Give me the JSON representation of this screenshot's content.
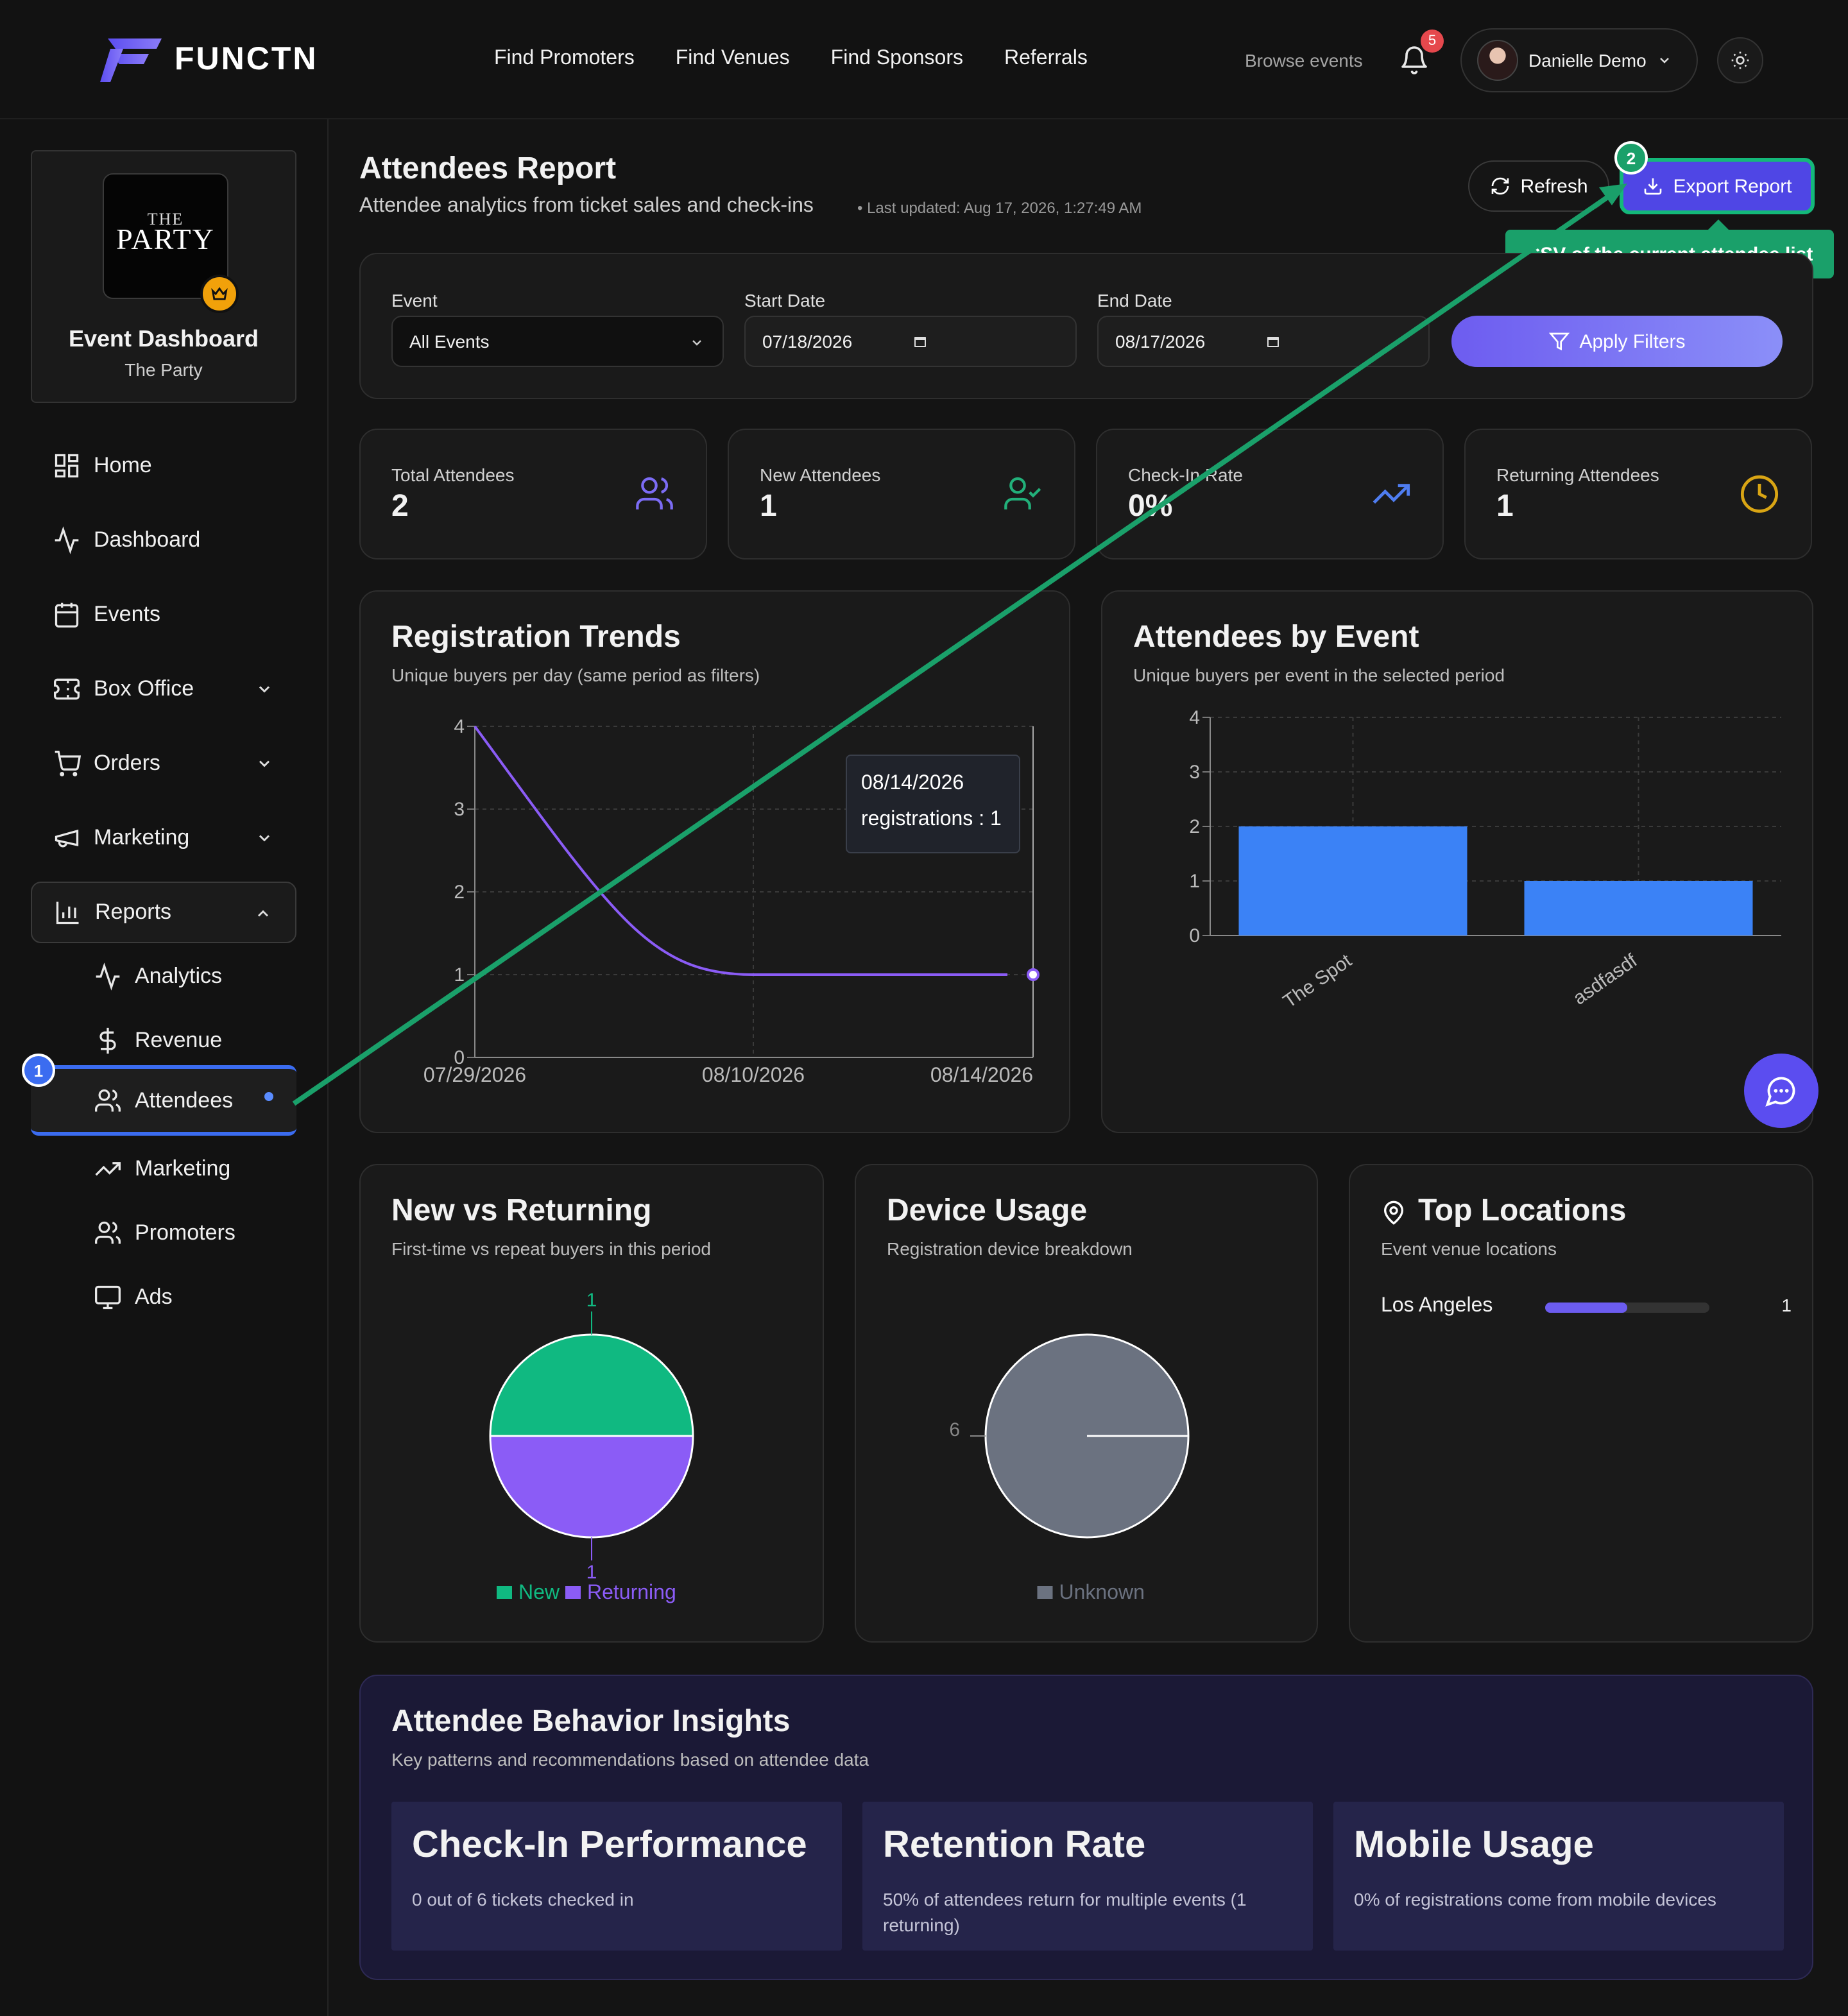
{
  "app": {
    "brand": "FUNCTN",
    "nav_links": [
      "Find Promoters",
      "Find Venues",
      "Find Sponsors",
      "Referrals"
    ],
    "browse_events": "Browse events",
    "notifications_count": "5",
    "user_name": "Danielle Demo"
  },
  "sidebar": {
    "org_logo_small": "THE",
    "org_logo_big": "PARTY",
    "org_title": "Event Dashboard",
    "org_sub": "The Party",
    "items": [
      {
        "label": "Home",
        "icon": "grid-icon"
      },
      {
        "label": "Dashboard",
        "icon": "activity-icon"
      },
      {
        "label": "Events",
        "icon": "calendar-icon"
      },
      {
        "label": "Box Office",
        "icon": "ticket-icon"
      },
      {
        "label": "Orders",
        "icon": "cart-icon"
      },
      {
        "label": "Marketing",
        "icon": "megaphone-icon"
      },
      {
        "label": "Reports",
        "icon": "bar-chart-icon"
      }
    ],
    "report_sub_items": [
      {
        "label": "Analytics",
        "icon": "activity-icon"
      },
      {
        "label": "Revenue",
        "icon": "dollar-icon"
      },
      {
        "label": "Attendees",
        "icon": "users-icon"
      },
      {
        "label": "Marketing",
        "icon": "trending-up-icon"
      },
      {
        "label": "Promoters",
        "icon": "users-icon"
      },
      {
        "label": "Ads",
        "icon": "monitor-icon"
      }
    ]
  },
  "header": {
    "title": "Attendees Report",
    "subtitle": "Attendee analytics from ticket sales and check-ins",
    "last_updated": "• Last updated: Aug 17, 2026, 1:27:49 AM",
    "refresh_label": "Refresh",
    "export_label": "Export Report",
    "export_tooltip": "CSV of the current attendee list"
  },
  "annotations": {
    "step1": "1",
    "step2": "2",
    "accent": "#1aa06a"
  },
  "filters": {
    "event_label": "Event",
    "event_value": "All Events",
    "start_label": "Start Date",
    "start_value": "07/18/2026",
    "end_label": "End Date",
    "end_value": "08/17/2026",
    "apply_label": "Apply Filters"
  },
  "stats": [
    {
      "label": "Total Attendees",
      "value": "2",
      "icon": "users-icon",
      "color": "#7c6cf5"
    },
    {
      "label": "New Attendees",
      "value": "1",
      "icon": "user-check-icon",
      "color": "#22b07a"
    },
    {
      "label": "Check-In Rate",
      "value": "0%",
      "icon": "trending-up-icon",
      "color": "#4f7df0"
    },
    {
      "label": "Returning Attendees",
      "value": "1",
      "icon": "clock-icon",
      "color": "#d9a514"
    }
  ],
  "registration": {
    "title": "Registration Trends",
    "subtitle": "Unique buyers per day (same period as filters)",
    "tooltip_date": "08/14/2026",
    "tooltip_value": "registrations : 1"
  },
  "by_event": {
    "title": "Attendees by Event",
    "subtitle": "Unique buyers per event in the selected period"
  },
  "new_vs_returning": {
    "title": "New vs Returning",
    "subtitle": "First-time vs repeat buyers in this period"
  },
  "device": {
    "title": "Device Usage",
    "subtitle": "Registration device breakdown"
  },
  "locations": {
    "title": "Top Locations",
    "subtitle": "Event venue locations",
    "rows": [
      {
        "name": "Los Angeles",
        "count": "1",
        "fraction": 0.5
      }
    ]
  },
  "insights": {
    "title": "Attendee Behavior Insights",
    "subtitle": "Key patterns and recommendations based on attendee data",
    "boxes": [
      {
        "title": "Check-In Performance",
        "desc": "0 out of 6 tickets checked in"
      },
      {
        "title": "Retention Rate",
        "desc": "50% of attendees return for multiple events (1 returning)"
      },
      {
        "title": "Mobile Usage",
        "desc": "0% of registrations come from mobile devices"
      }
    ]
  },
  "chart_data": [
    {
      "type": "line",
      "x": [
        "07/29/2026",
        "08/10/2026",
        "08/14/2026"
      ],
      "y": [
        4,
        1,
        1
      ],
      "xlabel": "",
      "ylabel": "",
      "ylim": [
        0,
        4
      ],
      "yticks": [
        "0",
        "1",
        "2",
        "3",
        "4"
      ],
      "color": "#8b5cf6",
      "grid": true
    },
    {
      "type": "bar",
      "categories": [
        "The Spot",
        "asdfasdf"
      ],
      "values": [
        2,
        1
      ],
      "ylim": [
        0,
        4
      ],
      "yticks": [
        "0",
        "1",
        "2",
        "3",
        "4"
      ],
      "color": "#3b82f6",
      "grid": true
    },
    {
      "type": "pie",
      "labels": [
        "New",
        "Returning"
      ],
      "values": [
        1,
        1
      ],
      "value_labels": [
        "1",
        "1"
      ],
      "colors": [
        "#10b981",
        "#8b5cf6"
      ],
      "legend": "bottom"
    },
    {
      "type": "pie",
      "labels": [
        "Unknown"
      ],
      "values": [
        6
      ],
      "value_labels": [
        "6"
      ],
      "colors": [
        "#6b7280"
      ],
      "legend": "bottom"
    }
  ]
}
